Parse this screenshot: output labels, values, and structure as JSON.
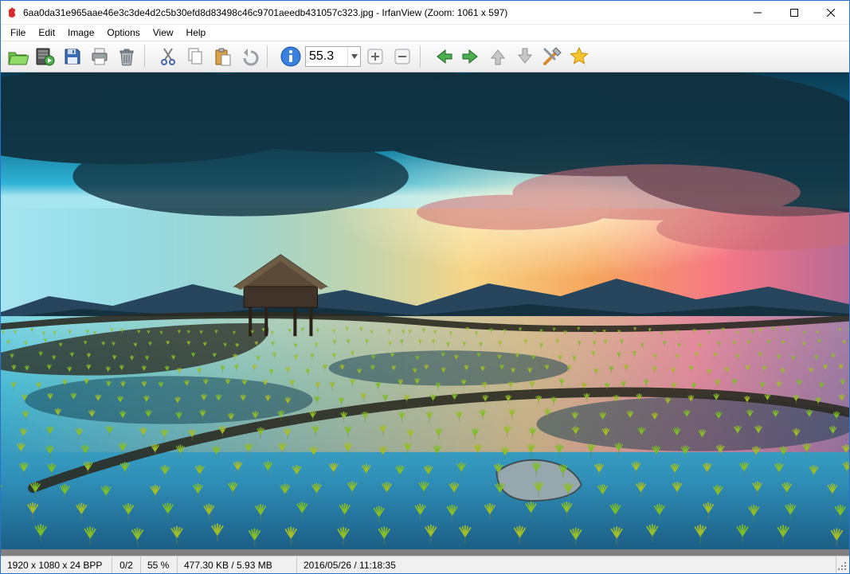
{
  "window": {
    "title": "6aa0da31e965aae46e3c3de4d2c5b30efd8d83498c46c9701aeedb431057c323.jpg - IrfanView (Zoom: 1061 x 597)"
  },
  "menu": {
    "items": [
      "File",
      "Edit",
      "Image",
      "Options",
      "View",
      "Help"
    ]
  },
  "toolbar": {
    "zoom_value": "55.3",
    "icons": {
      "open": "open-icon",
      "slideshow": "slideshow-icon",
      "save": "save-icon",
      "print": "print-icon",
      "delete": "delete-icon",
      "cut": "cut-icon",
      "copy": "copy-icon",
      "paste": "paste-icon",
      "undo": "undo-icon",
      "info": "info-icon",
      "zoom_in": "zoom-in-icon",
      "zoom_out": "zoom-out-icon",
      "prev": "prev-icon",
      "next": "next-icon",
      "up": "up-icon",
      "down": "down-icon",
      "settings": "settings-icon",
      "favorite": "favorite-icon"
    }
  },
  "statusbar": {
    "dimensions": "1920 x 1080 x 24 BPP",
    "index": "0/2",
    "zoom_pct": "55 %",
    "filesize": "477.30 KB / 5.93 MB",
    "datetime": "2016/05/26 / 11:18:35"
  }
}
